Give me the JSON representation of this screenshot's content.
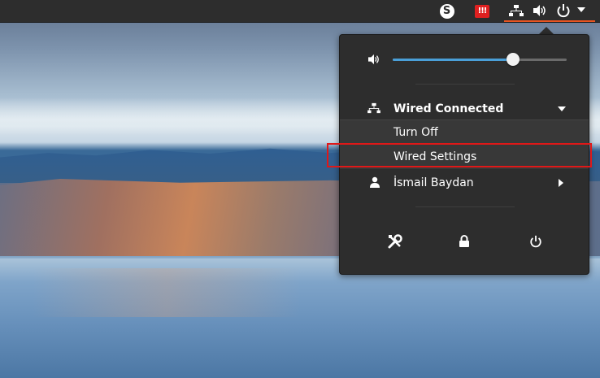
{
  "topbar": {
    "skype_letter": "S",
    "red_app_letters": "!!!",
    "indicators": [
      "network-icon",
      "volume-icon",
      "power-icon",
      "menu-arrow-icon"
    ],
    "active_underline_color": "#e95420"
  },
  "menu": {
    "volume": {
      "level_fraction": 0.69
    },
    "network": {
      "label": "Wired Connected",
      "submenu": {
        "turn_off": "Turn Off",
        "settings": "Wired Settings"
      }
    },
    "user": {
      "name": "İsmail Baydan"
    },
    "bottom_buttons": [
      "settings-icon",
      "lock-icon",
      "power-off-icon"
    ]
  },
  "colors": {
    "panel_bg": "#2d2d2d",
    "slider_fill": "#4a9fd8",
    "highlight": "#e01818"
  }
}
